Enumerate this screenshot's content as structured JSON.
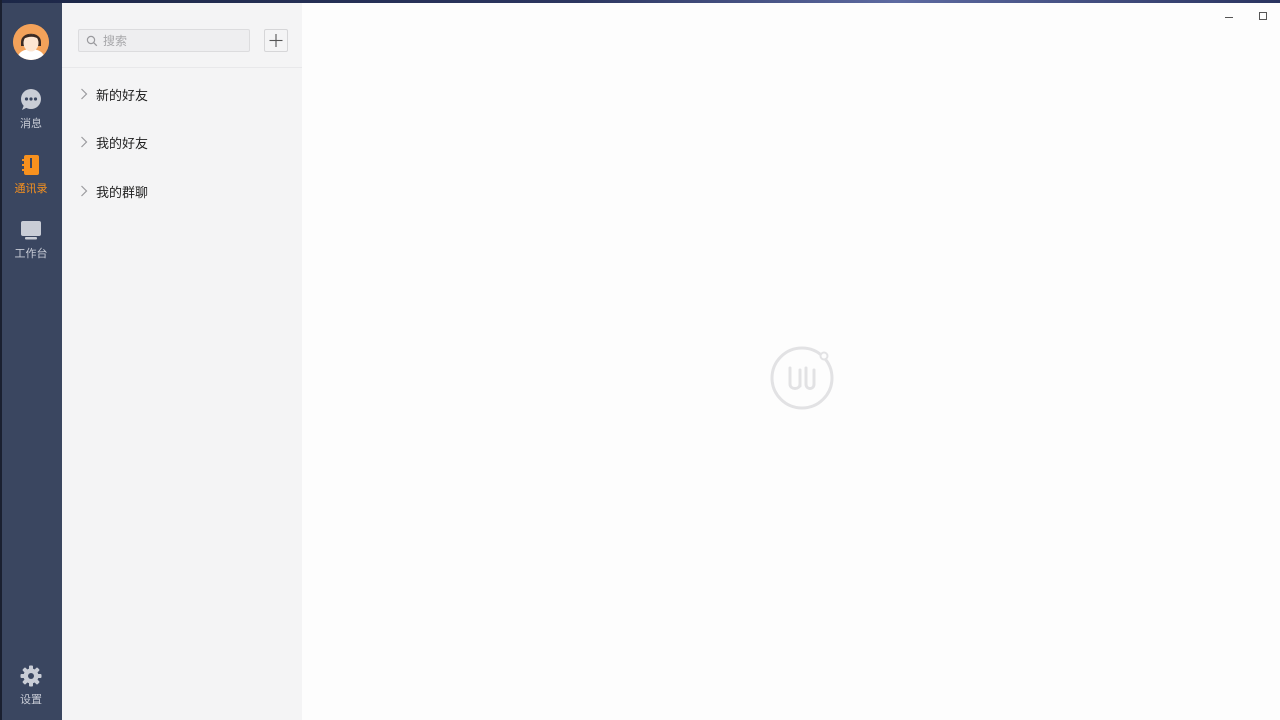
{
  "nav": {
    "items": [
      {
        "label": "消息",
        "icon": "chat-icon",
        "active": false
      },
      {
        "label": "通讯录",
        "icon": "contacts-book-icon",
        "active": true
      },
      {
        "label": "工作台",
        "icon": "workbench-icon",
        "active": false
      },
      {
        "label": "设置",
        "icon": "gear-icon",
        "active": false
      }
    ]
  },
  "search": {
    "placeholder": "搜索",
    "value": ""
  },
  "contacts": {
    "groups": [
      {
        "label": "新的好友"
      },
      {
        "label": "我的好友"
      },
      {
        "label": "我的群聊"
      }
    ]
  },
  "colors": {
    "rail_bg": "#3a4660",
    "accent": "#f7911e",
    "panel_bg": "#f4f4f5",
    "main_bg": "#fdfdfd"
  }
}
